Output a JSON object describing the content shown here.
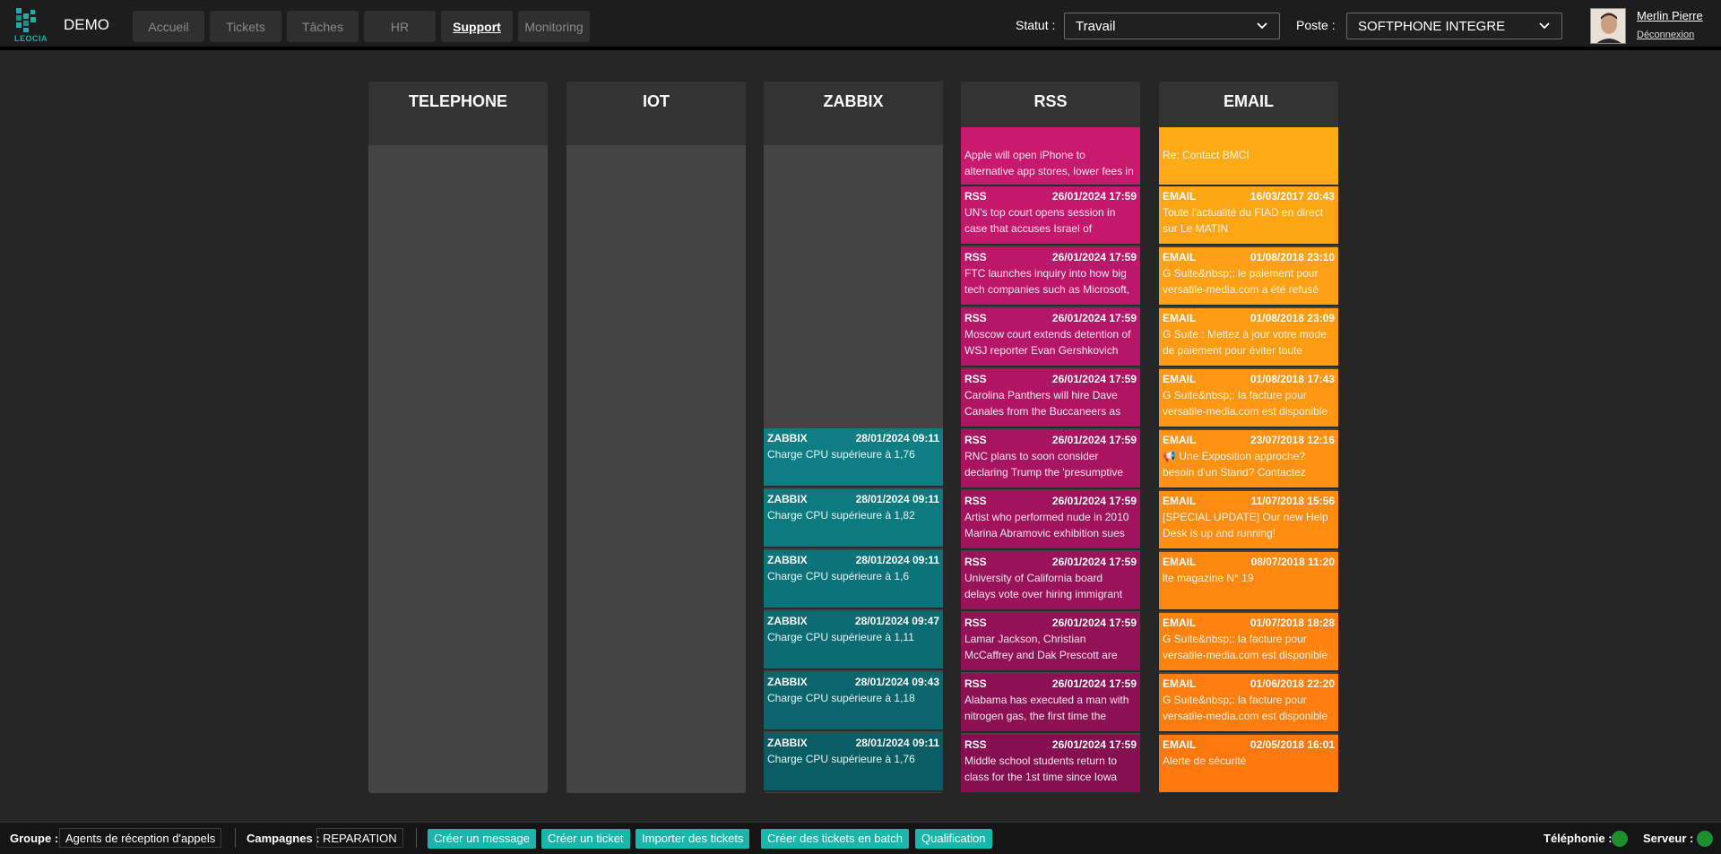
{
  "app": {
    "logo_text": "LEOCIA",
    "name": "DEMO"
  },
  "nav": {
    "tabs": [
      "Accueil",
      "Tickets",
      "Tâches",
      "HR",
      "Support",
      "Monitoring"
    ],
    "active": "Support"
  },
  "status": {
    "label": "Statut :",
    "value": "Travail"
  },
  "poste": {
    "label": "Poste :",
    "value": "SOFTPHONE INTEGRE"
  },
  "user": {
    "name": "Merlin Pierre",
    "logout": "Déconnexion"
  },
  "columns": [
    {
      "title": "TELEPHONE",
      "cards": []
    },
    {
      "title": "IOT",
      "cards": []
    },
    {
      "title": "ZABBIX",
      "cards": [
        {
          "source": "ZABBIX",
          "date": "28/01/2024 09:11",
          "text": "Charge CPU supérieure à 1,76"
        },
        {
          "source": "ZABBIX",
          "date": "28/01/2024 09:11",
          "text": "Charge CPU supérieure à 1,82"
        },
        {
          "source": "ZABBIX",
          "date": "28/01/2024 09:11",
          "text": "Charge CPU supérieure à 1,6"
        },
        {
          "source": "ZABBIX",
          "date": "28/01/2024 09:47",
          "text": "Charge CPU supérieure à 1,11"
        },
        {
          "source": "ZABBIX",
          "date": "28/01/2024 09:43",
          "text": "Charge CPU supérieure à 1,18"
        },
        {
          "source": "ZABBIX",
          "date": "28/01/2024 09:11",
          "text": "Charge CPU supérieure à 1,76"
        }
      ]
    },
    {
      "title": "RSS",
      "partial_top": "Apple will open iPhone to alternative app stores, lower fees in",
      "cards": [
        {
          "source": "RSS",
          "date": "26/01/2024 17:59",
          "text": "UN's top court opens session in case that accuses Israel of"
        },
        {
          "source": "RSS",
          "date": "26/01/2024 17:59",
          "text": "FTC launches inquiry into how big tech companies such as Microsoft,"
        },
        {
          "source": "RSS",
          "date": "26/01/2024 17:59",
          "text": "Moscow court extends detention of WSJ reporter Evan Gershkovich"
        },
        {
          "source": "RSS",
          "date": "26/01/2024 17:59",
          "text": "Carolina Panthers will hire Dave Canales from the Buccaneers as"
        },
        {
          "source": "RSS",
          "date": "26/01/2024 17:59",
          "text": "RNC plans to soon consider declaring Trump the 'presumptive"
        },
        {
          "source": "RSS",
          "date": "26/01/2024 17:59",
          "text": "Artist who performed nude in 2010 Marina Abramovic exhibition sues"
        },
        {
          "source": "RSS",
          "date": "26/01/2024 17:59",
          "text": "University of California board delays vote over hiring immigrant"
        },
        {
          "source": "RSS",
          "date": "26/01/2024 17:59",
          "text": "Lamar Jackson, Christian McCaffrey and Dak Prescott are"
        },
        {
          "source": "RSS",
          "date": "26/01/2024 17:59",
          "text": "Alabama has executed a man with nitrogen gas, the first time the"
        },
        {
          "source": "RSS",
          "date": "26/01/2024 17:59",
          "text": "Middle school students return to class for the 1st time since Iowa"
        }
      ]
    },
    {
      "title": "EMAIL",
      "partial_top": "Re: Contact BMCI",
      "cards": [
        {
          "source": "EMAIL",
          "date": "16/03/2017 20:43",
          "text": "Toute l'actualité du FIAD en direct sur Le MATIN"
        },
        {
          "source": "EMAIL",
          "date": "01/08/2018 23:10",
          "text": "G Suite&nbsp;: le paiement pour versatile-media.com a été refusé"
        },
        {
          "source": "EMAIL",
          "date": "01/08/2018 23:09",
          "text": "G Suite : Mettez à jour votre mode de paiement pour éviter toute"
        },
        {
          "source": "EMAIL",
          "date": "01/08/2018 17:43",
          "text": "G Suite&nbsp;: la facture pour versatile-media.com est disponible"
        },
        {
          "source": "EMAIL",
          "date": "23/07/2018 12:16",
          "text": "📢 Une Exposition approche? besoin d'un Stand? Contactez"
        },
        {
          "source": "EMAIL",
          "date": "11/07/2018 15:56",
          "text": "[SPECIAL UPDATE] Our new Help Desk is up and running!"
        },
        {
          "source": "EMAIL",
          "date": "08/07/2018 11:20",
          "text": "lte magazine N° 19"
        },
        {
          "source": "EMAIL",
          "date": "01/07/2018 18:28",
          "text": "G Suite&nbsp;: la facture pour versatile-media.com est disponible"
        },
        {
          "source": "EMAIL",
          "date": "01/06/2018 22:20",
          "text": "G Suite&nbsp;: la facture pour versatile-media.com est disponible"
        },
        {
          "source": "EMAIL",
          "date": "02/05/2018 16:01",
          "text": "Alerte de sécurité"
        }
      ]
    }
  ],
  "footer": {
    "group_label": "Groupe :",
    "group_value": "Agents de réception d'appels",
    "campaign_label": "Campagnes :",
    "campaign_value": "REPARATION",
    "buttons": [
      "Créer un message",
      "Créer un ticket",
      "Importer des tickets",
      "Créer des tickets en batch",
      "Qualification"
    ],
    "telephony_label": "Téléphonie :",
    "server_label": "Serveur :"
  },
  "colors": {
    "accent": "#1ab5ab",
    "rss": "#c2186e",
    "email": "#ff8c12",
    "zabbix": "#0d7f85",
    "status_ok": "#1f8f2d"
  }
}
